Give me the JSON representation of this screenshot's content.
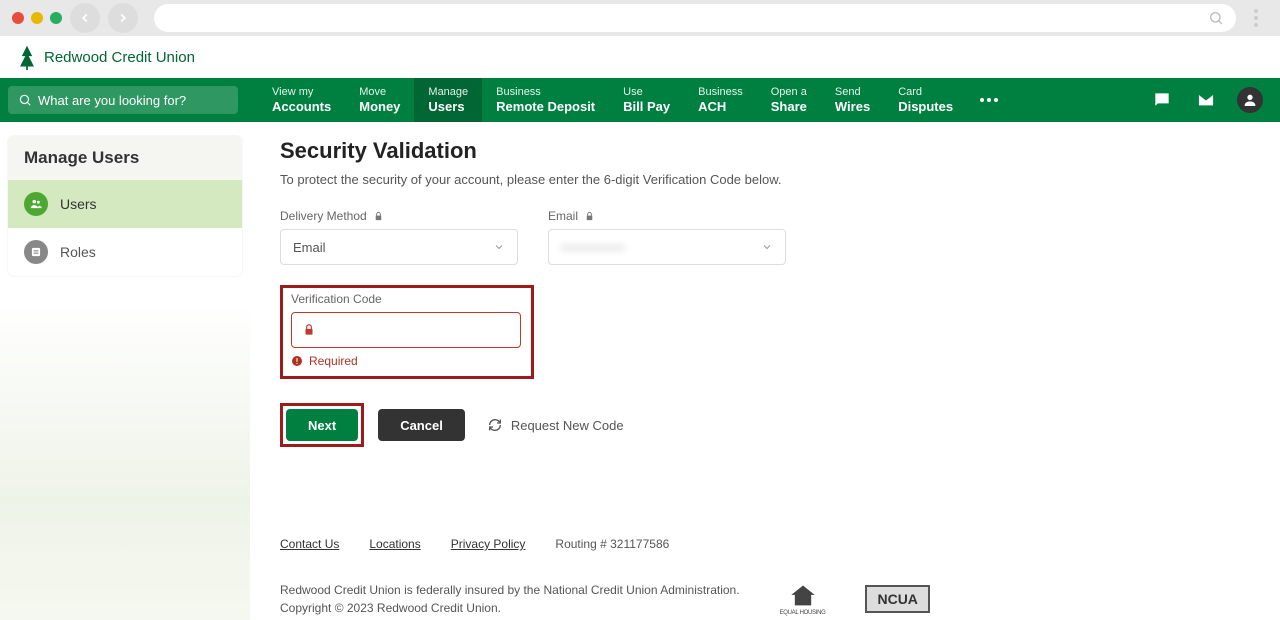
{
  "logo_text": "Redwood Credit Union",
  "nav_search_placeholder": "What are you looking for?",
  "nav": [
    {
      "top": "View my",
      "bottom": "Accounts"
    },
    {
      "top": "Move",
      "bottom": "Money"
    },
    {
      "top": "Manage",
      "bottom": "Users"
    },
    {
      "top": "Business",
      "bottom": "Remote Deposit"
    },
    {
      "top": "Use",
      "bottom": "Bill Pay"
    },
    {
      "top": "Business",
      "bottom": "ACH"
    },
    {
      "top": "Open a",
      "bottom": "Share"
    },
    {
      "top": "Send",
      "bottom": "Wires"
    },
    {
      "top": "Card",
      "bottom": "Disputes"
    }
  ],
  "sidebar": {
    "title": "Manage Users",
    "items": [
      {
        "label": "Users"
      },
      {
        "label": "Roles"
      }
    ]
  },
  "page": {
    "title": "Security Validation",
    "subtitle": "To protect the security of your account, please enter the 6-digit Verification Code below.",
    "delivery_label": "Delivery Method",
    "delivery_value": "Email",
    "email_label": "Email",
    "email_value": "••••••••••••••",
    "code_label": "Verification Code",
    "code_error": "Required",
    "next_label": "Next",
    "cancel_label": "Cancel",
    "request_label": "Request New Code"
  },
  "footer": {
    "links": [
      "Contact Us",
      "Locations",
      "Privacy Policy"
    ],
    "routing": "Routing # 321177586",
    "line1": "Redwood Credit Union is federally insured by the National Credit Union Administration.",
    "line2": "Copyright © 2023 Redwood Credit Union.",
    "ncua": "NCUA"
  }
}
